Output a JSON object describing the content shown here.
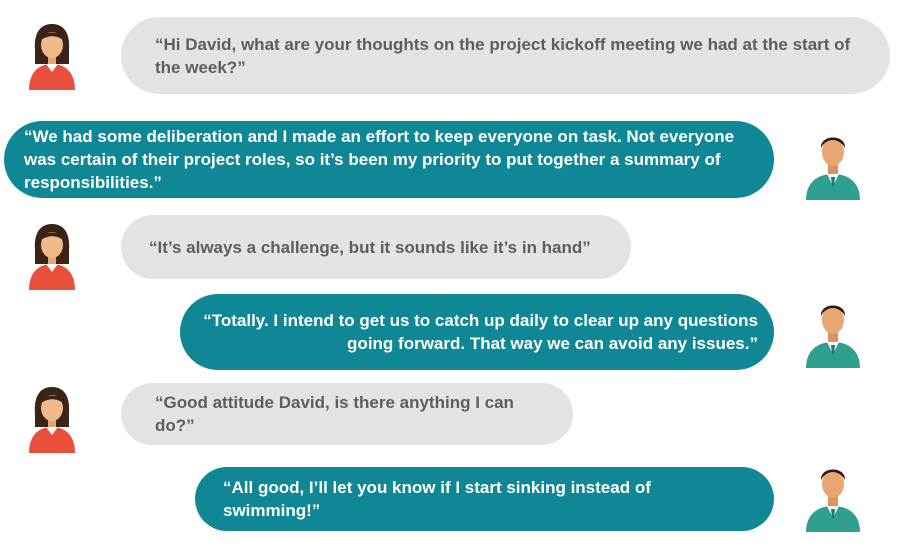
{
  "messages": [
    {
      "speaker": "woman",
      "text": "“Hi David, what are your thoughts on the project kickoff meeting we had at the start of the week?”"
    },
    {
      "speaker": "man",
      "text": "“We had some deliberation and I made an effort to keep everyone on task. Not everyone was certain of their project roles, so it’s been my priority to put together a summary of responsibilities.”"
    },
    {
      "speaker": "woman",
      "text": "“It’s always a challenge, but it sounds like it’s in hand”"
    },
    {
      "speaker": "man",
      "text": "“Totally. I intend to get us to catch up daily to clear up any questions going forward. That way we can avoid any issues.”"
    },
    {
      "speaker": "woman",
      "text": "“Good attitude David, is there anything I can do?”"
    },
    {
      "speaker": "man",
      "text": "“All good, I’ll let you know if I start sinking instead of swimming!”"
    }
  ],
  "colors": {
    "gray_bubble": "#e3e3e3",
    "gray_text": "#5e5e5e",
    "teal_bubble": "#0f8794",
    "woman_shirt": "#e8503c",
    "man_shirt": "#2fa08f"
  },
  "icons": {
    "woman": "woman-avatar-icon",
    "man": "man-avatar-icon"
  }
}
